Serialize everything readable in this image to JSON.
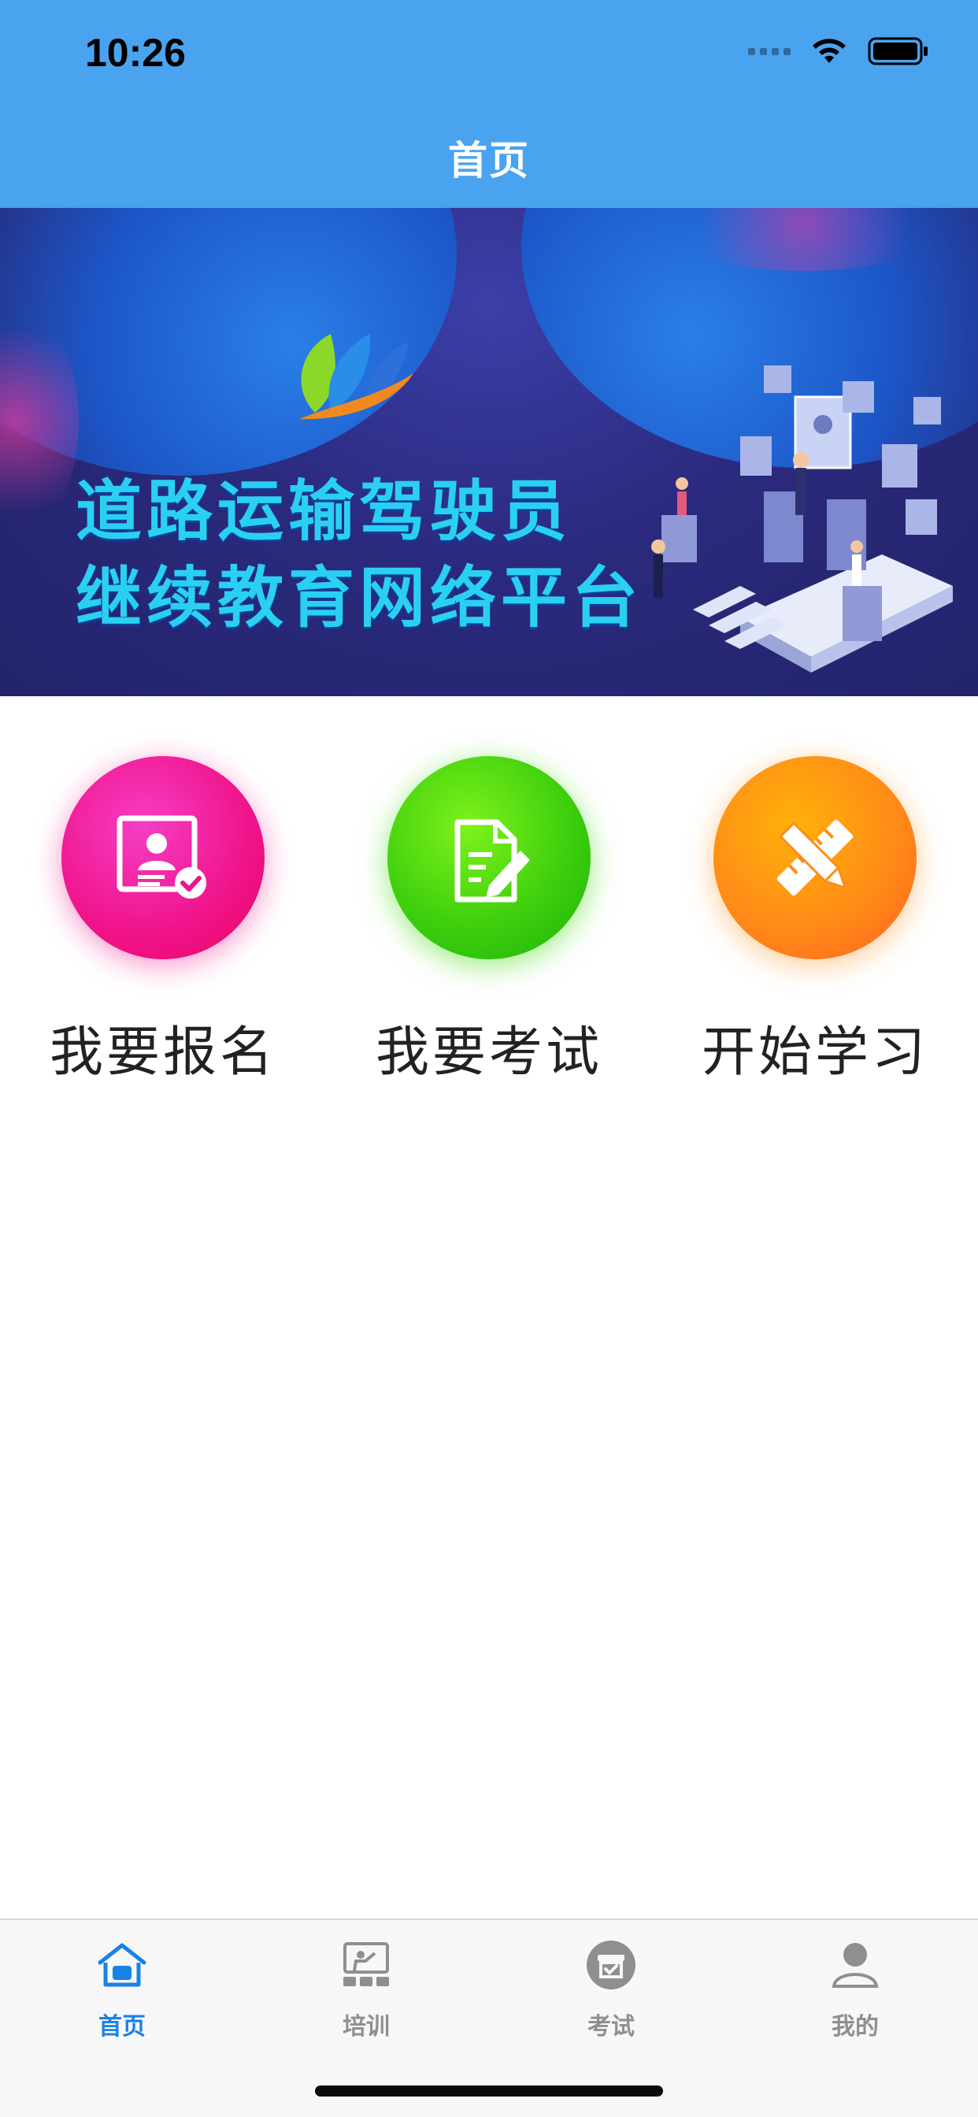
{
  "status_bar": {
    "time": "10:26"
  },
  "nav": {
    "title": "首页"
  },
  "banner": {
    "line1": "道路运输驾驶员",
    "line2": "继续教育网络平台",
    "slide_count": 4,
    "active_slide": 0
  },
  "shortcuts": [
    {
      "label": "我要报名",
      "icon": "id-card-icon",
      "color": "#f0138a"
    },
    {
      "label": "我要考试",
      "icon": "exam-paper-icon",
      "color": "#3fcf0e"
    },
    {
      "label": "开始学习",
      "icon": "pencil-ruler-icon",
      "color": "#ff8c17"
    }
  ],
  "tabbar": {
    "items": [
      {
        "label": "首页",
        "icon": "home-icon",
        "active": true
      },
      {
        "label": "培训",
        "icon": "training-icon",
        "active": false
      },
      {
        "label": "考试",
        "icon": "exam-icon",
        "active": false
      },
      {
        "label": "我的",
        "icon": "profile-icon",
        "active": false
      }
    ],
    "active_color": "#1a82e6",
    "inactive_color": "#8f8f8f"
  },
  "colors": {
    "header": "#4aa3ef"
  }
}
